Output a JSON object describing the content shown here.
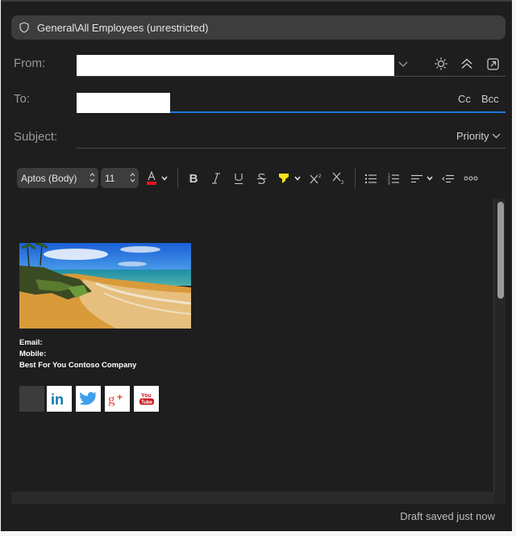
{
  "sensitivity": {
    "label": "General\\All Employees (unrestricted)",
    "icon": "shield-icon"
  },
  "header": {
    "from_label": "From:",
    "to_label": "To:",
    "subject_label": "Subject:",
    "from_value": "",
    "to_value": "",
    "subject_value": "",
    "cc_label": "Cc",
    "bcc_label": "Bcc",
    "priority_label": "Priority",
    "icons": [
      "chevron-down-icon",
      "sun-icon",
      "collapse-icon",
      "pop-out-icon"
    ]
  },
  "toolbar": {
    "font_name": "Aptos (Body)",
    "font_size": "11",
    "font_color": "#e8141b",
    "highlight_color": "#f5e51c",
    "buttons": [
      "font-color",
      "bold",
      "italic",
      "underline",
      "strikethrough",
      "highlight",
      "superscript",
      "subscript",
      "bullets",
      "numbering",
      "align",
      "outdent",
      "more"
    ]
  },
  "signature": {
    "email_label": "Email:",
    "mobile_label": "Mobile:",
    "company": "Best For You Contoso Company",
    "social": [
      "placeholder",
      "linkedin",
      "twitter",
      "google-plus",
      "youtube"
    ]
  },
  "status": {
    "text": "Draft saved just now"
  }
}
